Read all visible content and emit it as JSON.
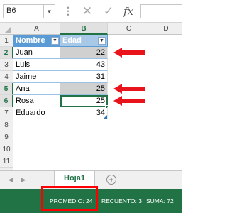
{
  "formula_bar": {
    "name_box": "B6",
    "cancel_icon": "✕",
    "enter_icon": "✓",
    "fx_icon": "fx"
  },
  "columns": [
    "A",
    "B",
    "C",
    "D"
  ],
  "rows": [
    "1",
    "2",
    "3",
    "4",
    "5",
    "6",
    "7",
    "8",
    "9",
    "10",
    "11",
    "12"
  ],
  "table": {
    "headers": [
      "Nombre",
      "Edad"
    ],
    "data": [
      {
        "nombre": "Juan",
        "edad": "22"
      },
      {
        "nombre": "Luis",
        "edad": "43"
      },
      {
        "nombre": "Jaime",
        "edad": "31"
      },
      {
        "nombre": "Ana",
        "edad": "25"
      },
      {
        "nombre": "Rosa",
        "edad": "25"
      },
      {
        "nombre": "Eduardo",
        "edad": "34"
      }
    ]
  },
  "sheet_tabs": {
    "active": "Hoja1",
    "add_icon": "+"
  },
  "status_bar": {
    "promedio": "PROMEDIO: 24",
    "recuento": "RECUENTO: 3",
    "suma": "SUMA: 72"
  },
  "colors": {
    "excel_green": "#217346",
    "table_header": "#5b9bd5",
    "highlight": "#ff0000"
  }
}
